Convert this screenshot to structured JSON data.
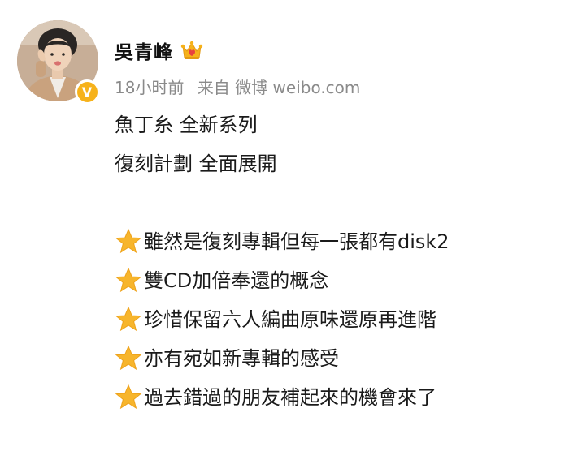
{
  "post": {
    "author": {
      "name": "吳青峰",
      "verified_badge": "V",
      "avatar_icon": "user-avatar",
      "member_icon": "crown-icon"
    },
    "meta": {
      "time": "18小时前",
      "source": "来自 微博 weibo.com"
    },
    "lines": [
      "魚丁糸 全新系列",
      "復刻計劃 全面展開"
    ],
    "bullet_icon": "star-icon",
    "bullets": [
      "雖然是復刻專輯但每一張都有disk2",
      "雙CD加倍奉還的概念",
      "珍惜保留六人編曲原味還原再進階",
      "亦有宛如新專輯的感受",
      "過去錯過的朋友補起來的機會來了"
    ],
    "colors": {
      "text": "#1a1a1a",
      "meta": "#8a8a8a",
      "verified": "#f6b21b",
      "star": "#f7b52c"
    }
  }
}
